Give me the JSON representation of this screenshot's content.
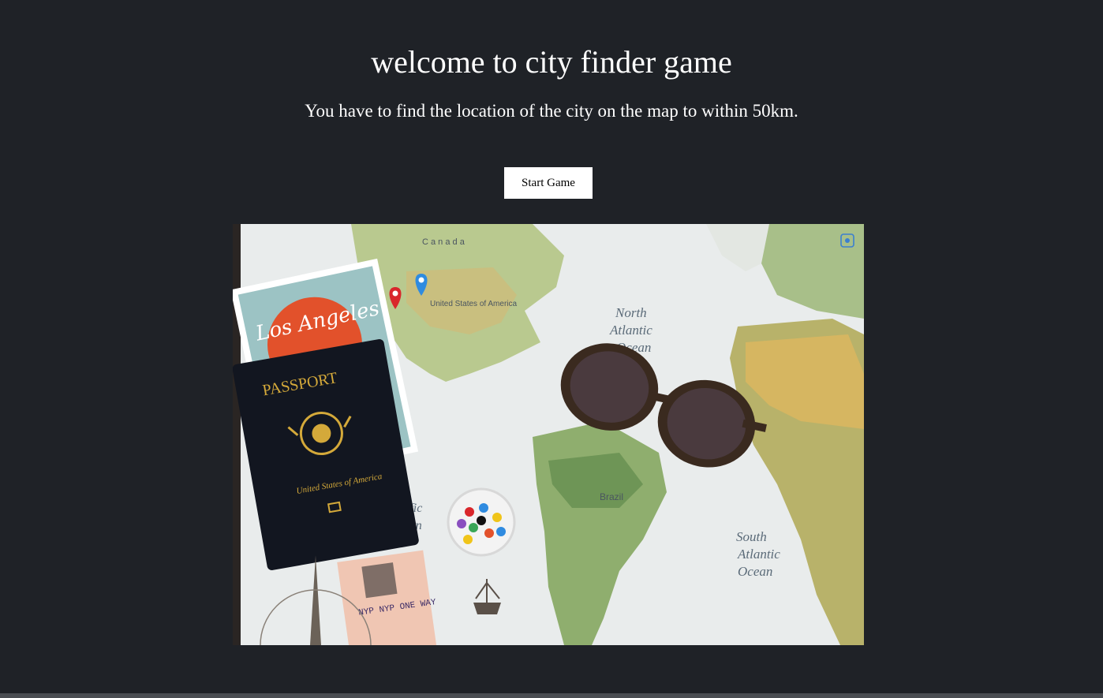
{
  "page": {
    "title": "welcome to city finder game",
    "subtitle": "You have to find the location of the city on the map to within 50km."
  },
  "actions": {
    "start_label": "Start Game"
  },
  "hero_image": {
    "map_labels": {
      "north_atlantic_1": "North",
      "north_atlantic_2": "Atlantic",
      "north_atlantic_3": "Ocean",
      "south_atlantic_1": "South",
      "south_atlantic_2": "Atlantic",
      "south_atlantic_3": "Ocean",
      "brazil": "Brazil",
      "pacific_1": "Pacific",
      "pacific_2": "Ocean",
      "canada": "C a n a d a",
      "usa": "United States of America"
    },
    "postcard_text": "Los Angeles",
    "passport_title": "PASSPORT",
    "passport_country": "United States of America",
    "ticket_text": "NYP NYP ONE WAY"
  },
  "colors": {
    "background": "#1f2227",
    "button_bg": "#ffffff",
    "pin_red": "#d9262b",
    "pin_blue": "#2f8be0"
  }
}
